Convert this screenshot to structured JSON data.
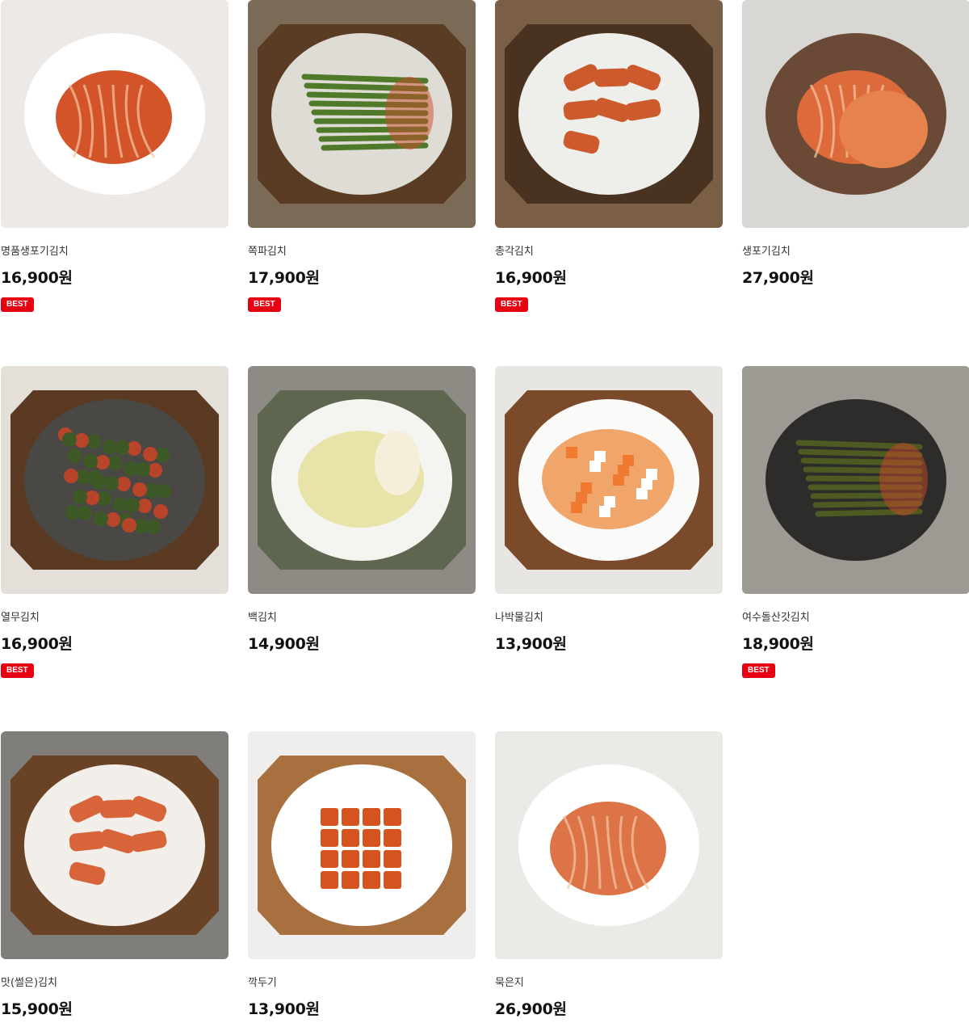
{
  "colors": {
    "badge": "#e60012",
    "price": "#111111",
    "name": "#333333"
  },
  "products": [
    {
      "name": "명품생포기김치",
      "price": "16,900원",
      "badge": "BEST",
      "image": "whole-cabbage-kimchi-photo"
    },
    {
      "name": "쪽파김치",
      "price": "17,900원",
      "badge": "BEST",
      "image": "green-onion-kimchi-photo"
    },
    {
      "name": "총각김치",
      "price": "16,900원",
      "badge": "BEST",
      "image": "ponytail-radish-kimchi-photo"
    },
    {
      "name": "생포기김치",
      "price": "27,900원",
      "badge": "",
      "image": "fresh-cabbage-kimchi-photo"
    },
    {
      "name": "열무김치",
      "price": "16,900원",
      "badge": "BEST",
      "image": "young-radish-kimchi-photo"
    },
    {
      "name": "백김치",
      "price": "14,900원",
      "badge": "",
      "image": "white-kimchi-photo"
    },
    {
      "name": "나박물김치",
      "price": "13,900원",
      "badge": "",
      "image": "water-kimchi-photo"
    },
    {
      "name": "여수돌산갓김치",
      "price": "18,900원",
      "badge": "BEST",
      "image": "mustard-leaf-kimchi-photo"
    },
    {
      "name": "맛(썰은)김치",
      "price": "15,900원",
      "badge": "",
      "image": "sliced-kimchi-photo"
    },
    {
      "name": "깍두기",
      "price": "13,900원",
      "badge": "",
      "image": "cubed-radish-kimchi-photo"
    },
    {
      "name": "묵은지",
      "price": "26,900원",
      "badge": "",
      "image": "aged-kimchi-photo"
    }
  ]
}
